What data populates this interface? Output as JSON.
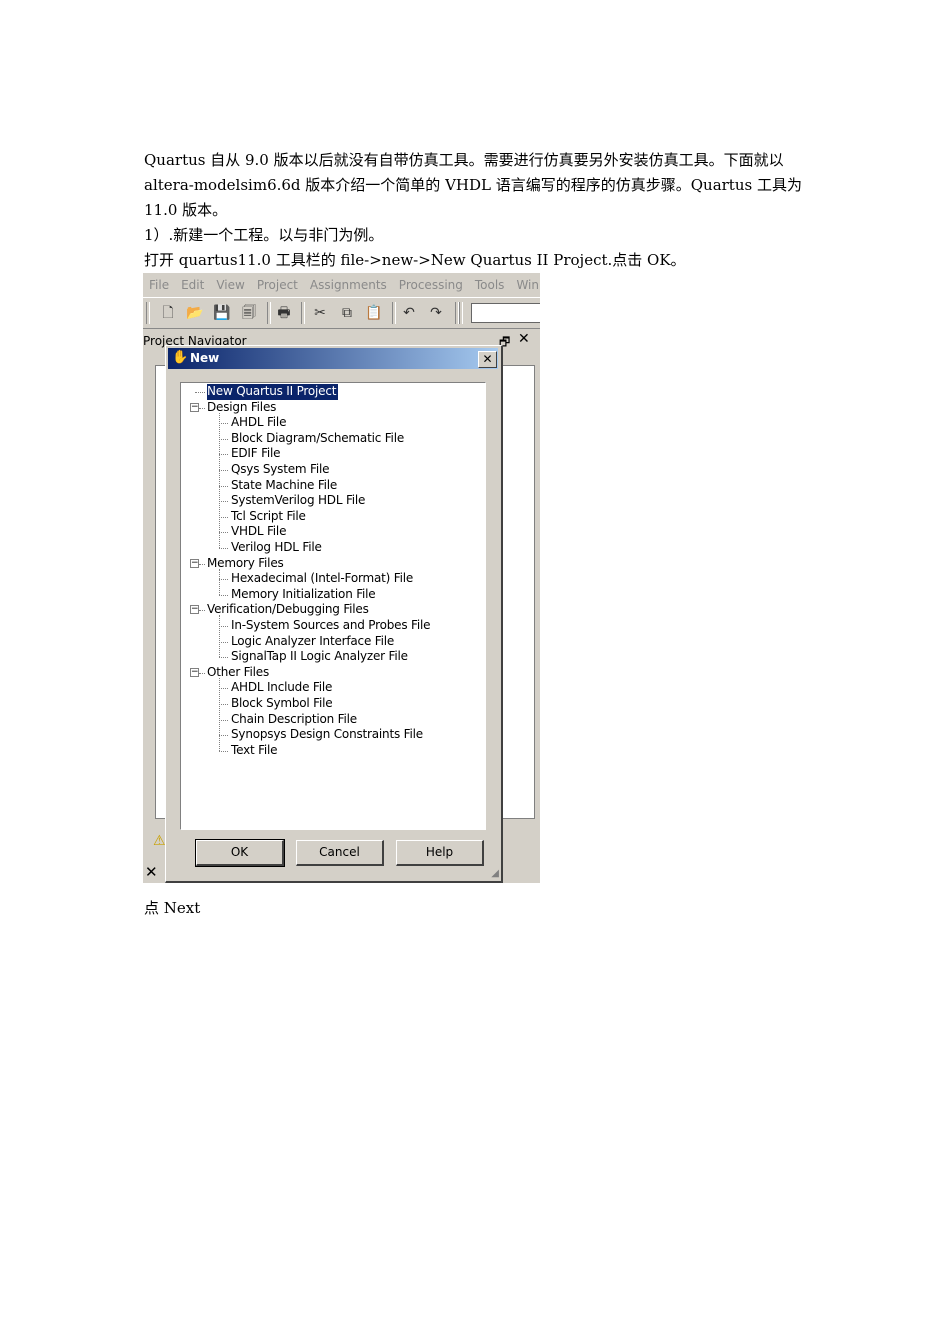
{
  "doc": {
    "p1": "Quartus 自从 9.0 版本以后就没有自带仿真工具。需要进行仿真要另外安装仿真工具。下面就以 altera-modelsim6.6d 版本介绍一个简单的 VHDL 语言编写的程序的仿真步骤。Quartus 工具为 11.0 版本。",
    "p2": "1）.新建一个工程。以与非门为例。",
    "p3": "打开 quartus11.0 工具栏的 file->new->New Quartus II Project.点击 OK。",
    "p4": "点 Next"
  },
  "app": {
    "menu": [
      "File",
      "Edit",
      "View",
      "Project",
      "Assignments",
      "Processing",
      "Tools",
      "Win"
    ],
    "toolbar_icons": [
      "new-icon",
      "open-icon",
      "save-icon",
      "save-all-icon",
      "print-icon",
      "cut-icon",
      "copy-icon",
      "paste-icon",
      "undo-icon",
      "redo-icon"
    ],
    "navigator_title": "Project Navigator"
  },
  "dialog": {
    "title": "New",
    "close": "✕",
    "tree": [
      {
        "label": "New Quartus II Project",
        "level": 0,
        "selected": true,
        "group": false
      },
      {
        "label": "Design Files",
        "level": 0,
        "group": true
      },
      {
        "label": "AHDL File",
        "level": 1
      },
      {
        "label": "Block Diagram/Schematic File",
        "level": 1
      },
      {
        "label": "EDIF File",
        "level": 1
      },
      {
        "label": "Qsys System File",
        "level": 1
      },
      {
        "label": "State Machine File",
        "level": 1
      },
      {
        "label": "SystemVerilog HDL File",
        "level": 1
      },
      {
        "label": "Tcl Script File",
        "level": 1
      },
      {
        "label": "VHDL File",
        "level": 1
      },
      {
        "label": "Verilog HDL File",
        "level": 1
      },
      {
        "label": "Memory Files",
        "level": 0,
        "group": true
      },
      {
        "label": "Hexadecimal (Intel-Format) File",
        "level": 1
      },
      {
        "label": "Memory Initialization File",
        "level": 1
      },
      {
        "label": "Verification/Debugging Files",
        "level": 0,
        "group": true
      },
      {
        "label": "In-System Sources and Probes File",
        "level": 1
      },
      {
        "label": "Logic Analyzer Interface File",
        "level": 1
      },
      {
        "label": "SignalTap II Logic Analyzer File",
        "level": 1
      },
      {
        "label": "Other Files",
        "level": 0,
        "group": true
      },
      {
        "label": "AHDL Include File",
        "level": 1
      },
      {
        "label": "Block Symbol File",
        "level": 1
      },
      {
        "label": "Chain Description File",
        "level": 1
      },
      {
        "label": "Synopsys Design Constraints File",
        "level": 1
      },
      {
        "label": "Text File",
        "level": 1
      }
    ],
    "buttons": {
      "ok": "OK",
      "cancel": "Cancel",
      "help": "Help"
    }
  }
}
